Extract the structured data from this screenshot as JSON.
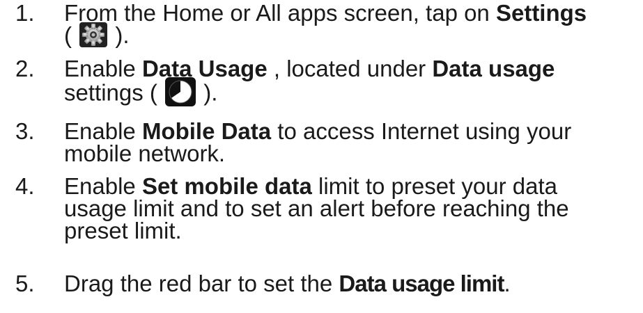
{
  "steps": [
    {
      "number": "1.",
      "text_a": "From the Home or All apps screen, tap on ",
      "bold_a": "Settings",
      "line2_open": "(",
      "icon": "gear-icon",
      "line2_close": ")."
    },
    {
      "number": "2.",
      "text_a": "Enable ",
      "bold_a": "Data Usage",
      "text_b": " , located under ",
      "bold_b": "Data usage",
      "line2_text": "settings (",
      "icon": "clock-icon",
      "line2_close": ")."
    },
    {
      "number": "3.",
      "text_a": "Enable ",
      "bold_a": "Mobile Data",
      "text_b": " to access Internet using your",
      "line2_text": "mobile network."
    },
    {
      "number": "4.",
      "text_a": "Enable ",
      "bold_a": "Set mobile data",
      "text_b": " limit to preset your data",
      "line2_text": "usage limit and to set an alert before reaching the",
      "line3_text": "preset limit."
    },
    {
      "number": "5.",
      "text_a": "Drag the red bar to set the ",
      "bold_a": "Data usage limit",
      "text_b": "."
    }
  ]
}
